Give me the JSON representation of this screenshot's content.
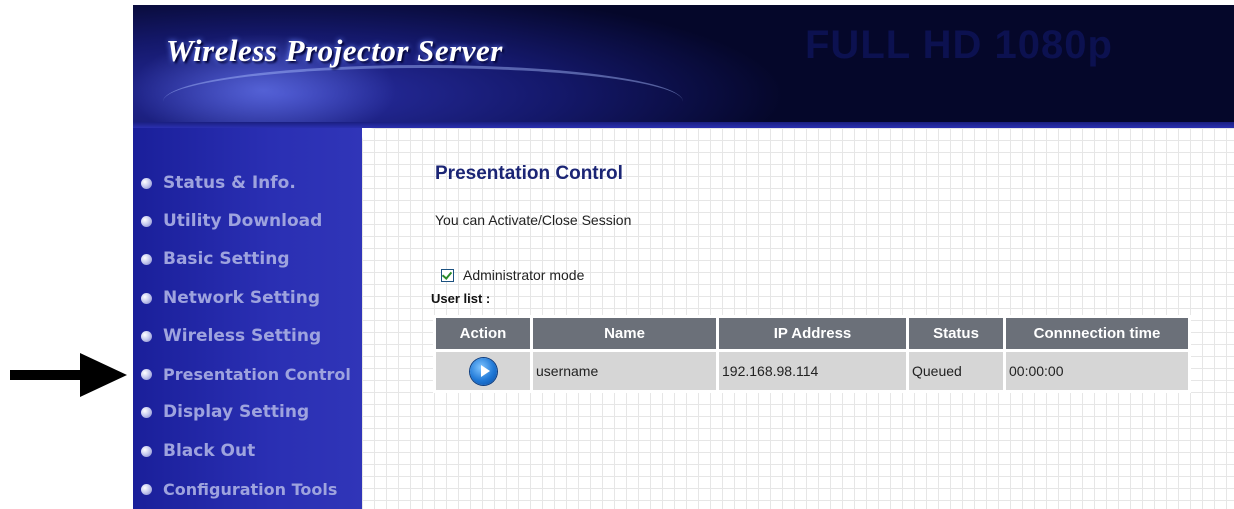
{
  "banner": {
    "title": "Wireless Projector Server",
    "watermark": "FULL HD 1080p"
  },
  "sidebar": {
    "items": [
      {
        "label": "Status & Info."
      },
      {
        "label": "Utility Download"
      },
      {
        "label": "Basic Setting"
      },
      {
        "label": "Network Setting"
      },
      {
        "label": "Wireless Setting"
      },
      {
        "label": "Presentation Control"
      },
      {
        "label": "Display Setting"
      },
      {
        "label": "Black Out"
      },
      {
        "label": "Configuration Tools"
      }
    ]
  },
  "main": {
    "title": "Presentation Control",
    "description": "You can Activate/Close Session",
    "admin_mode": {
      "label": "Administrator mode",
      "checked": true
    },
    "user_list_label": "User list :",
    "table": {
      "headers": [
        "Action",
        "Name",
        "IP Address",
        "Status",
        "Connnection time"
      ],
      "rows": [
        {
          "action_icon": "play-icon",
          "name": "username",
          "ip": "192.168.98.114",
          "status": "Queued",
          "time": "00:00:00"
        }
      ]
    }
  },
  "colors": {
    "sidebar_bg": "#2a2fb3",
    "sidebar_text": "#9ea3de",
    "title_text": "#1b2575",
    "table_header_bg": "#6b7079",
    "table_row_bg": "#d6d6d6"
  }
}
